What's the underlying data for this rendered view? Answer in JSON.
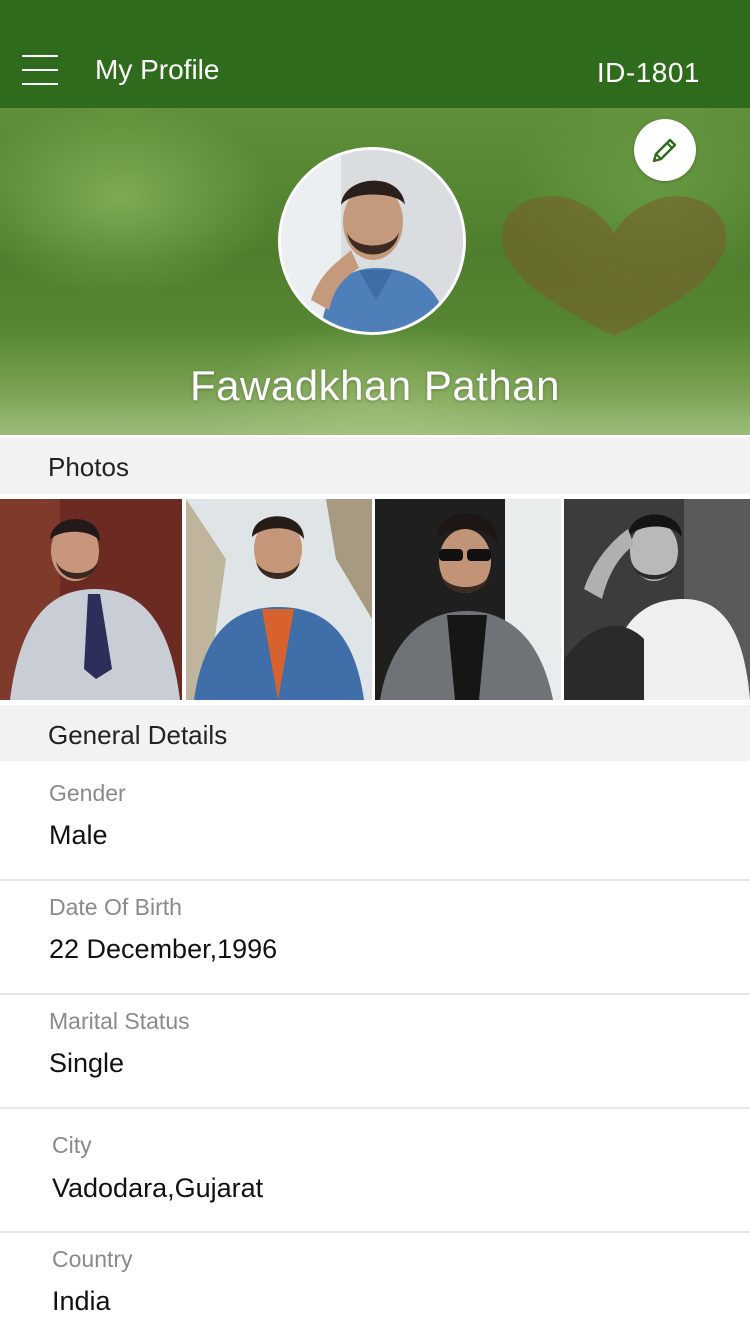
{
  "app_bar": {
    "title": "My Profile",
    "profile_id": "ID-1801",
    "background_color": "#2f6b1c",
    "menu_icon": "hamburger-menu-icon"
  },
  "profile": {
    "name": "Fawadkhan Pathan",
    "edit_icon": "pencil-icon",
    "accent_color": "#2f6b1c"
  },
  "photos_section": {
    "title": "Photos",
    "photos": [
      {
        "name": "photo-1"
      },
      {
        "name": "photo-2"
      },
      {
        "name": "photo-3"
      },
      {
        "name": "photo-4"
      }
    ]
  },
  "general_details": {
    "title": "General Details",
    "fields": [
      {
        "label": "Gender",
        "value": "Male"
      },
      {
        "label": "Date Of Birth",
        "value": "22 December,1996"
      },
      {
        "label": "Marital Status",
        "value": "Single"
      },
      {
        "label": "City",
        "value": "Vadodara,Gujarat"
      },
      {
        "label": "Country",
        "value": "India"
      }
    ]
  }
}
